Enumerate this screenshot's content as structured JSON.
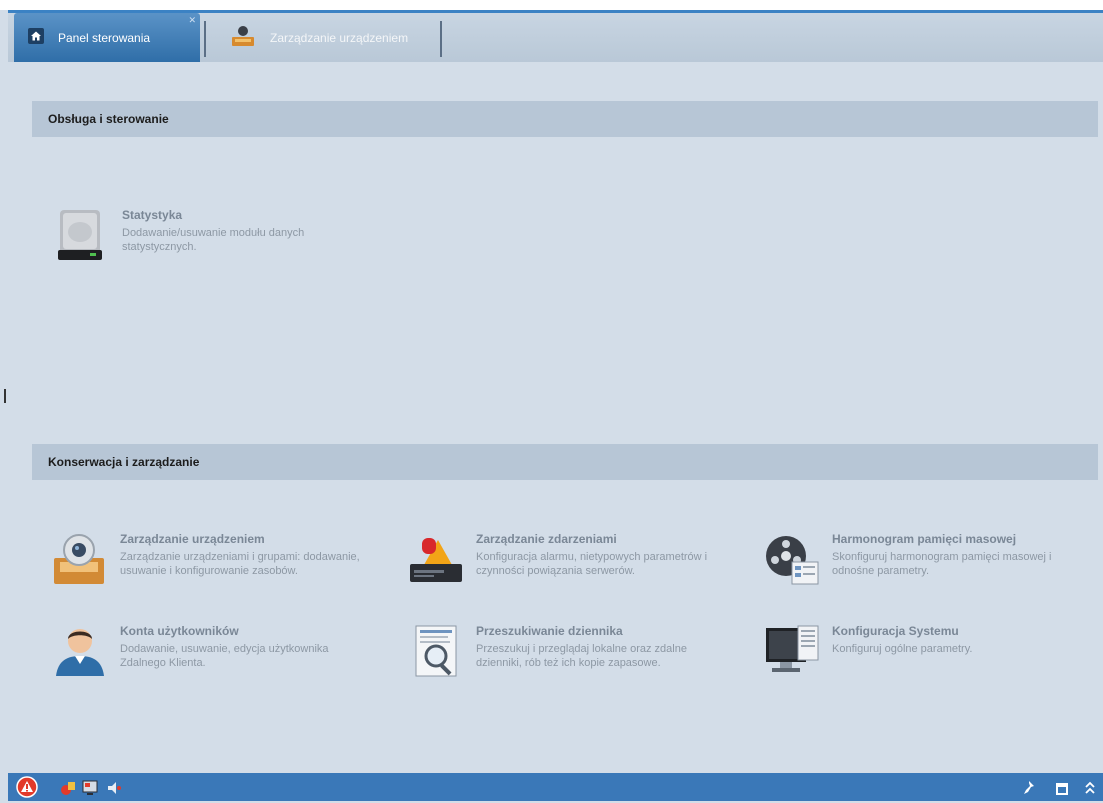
{
  "tabs": [
    {
      "label": "Panel sterowania",
      "icon": "home-icon",
      "active": true
    },
    {
      "label": "Zarządzanie urządzeniem",
      "icon": "device-user-icon",
      "active": false
    }
  ],
  "sections": [
    {
      "title": "Obsługa i sterowanie",
      "items": [
        {
          "title": "Statystyka",
          "description": "Dodawanie/usuwanie modułu danych statystycznych.",
          "icon": "hard-drive-icon"
        }
      ]
    },
    {
      "title": "Konserwacja i zarządzanie",
      "items": [
        {
          "title": "Zarządzanie urządzeniem",
          "description": "Zarządzanie urządzeniami i grupami: dodawanie, usuwanie i konfigurowanie zasobów.",
          "icon": "camera-box-icon"
        },
        {
          "title": "Zarządzanie zdarzeniami",
          "description": "Konfiguracja alarmu, nietypowych parametrów i czynności powiązania serwerów.",
          "icon": "alarm-recorder-icon"
        },
        {
          "title": "Harmonogram pamięci masowej",
          "description": "Skonfiguruj harmonogram pamięci masowej i odnośne parametry.",
          "icon": "film-reel-schedule-icon"
        },
        {
          "title": "Konta użytkowników",
          "description": "Dodawanie, usuwanie, edycja użytkownika Zdalnego Klienta.",
          "icon": "user-account-icon"
        },
        {
          "title": "Przeszukiwanie dziennika",
          "description": "Przeszukuj i przeglądaj lokalne oraz zdalne dzienniki, rób też ich kopie zapasowe.",
          "icon": "log-search-icon"
        },
        {
          "title": "Konfiguracja Systemu",
          "description": "Konfiguruj ogólne parametry.",
          "icon": "system-monitor-icon"
        }
      ]
    }
  ],
  "statusbar": {
    "left_icons": [
      "alarm-warning-icon",
      "record-icon",
      "monitor-icon",
      "audio-icon"
    ],
    "right_icons": [
      "pin-icon",
      "window-icon",
      "collapse-icon"
    ]
  },
  "colors": {
    "accent": "#3a78b8",
    "background": "#d3dde8",
    "section_header": "#b7c6d6",
    "alarm": "#e23a2a"
  }
}
